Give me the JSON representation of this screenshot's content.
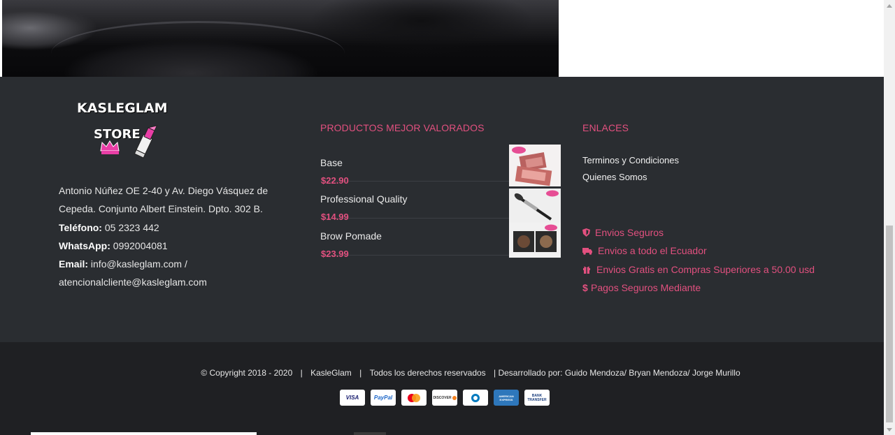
{
  "logo": {
    "line1": "KASLEGLAM",
    "line2": "STORE"
  },
  "address": {
    "street": "Antonio Núñez OE 2-40 y Av. Diego Vásquez de Cepeda. Conjunto Albert Einstein. Dpto. 302 B.",
    "phone_label": "Teléfono:",
    "phone": " 05 2323 442",
    "whatsapp_label": "WhatsApp:",
    "whatsapp": " 0992004081",
    "email_label": "Email:",
    "email": " info@kasleglam.com / atencionalcliente@kasleglam.com"
  },
  "products": {
    "title": "PRODUCTOS MEJOR VALORADOS",
    "items": [
      {
        "name": "Base",
        "price": "$22.90"
      },
      {
        "name": "Professional Quality",
        "price": "$14.99"
      },
      {
        "name": "Brow Pomade",
        "price": "$23.99"
      }
    ]
  },
  "links": {
    "title": "ENLACES",
    "items": [
      {
        "label": "Terminos y Condiciones"
      },
      {
        "label": "Quienes Somos"
      }
    ]
  },
  "features": [
    {
      "icon": "shield-icon",
      "label": "Envios Seguros"
    },
    {
      "icon": "truck-icon",
      "label": "Envios a todo el Ecuador"
    },
    {
      "icon": "gift-icon",
      "label": "Envios Gratis en Compras Superiores a 50.00 usd"
    },
    {
      "icon": "dollar-icon",
      "label": "Pagos Seguros Mediante"
    }
  ],
  "copyright": {
    "text": "© Copyright 2018 - 2020",
    "sep1": "|",
    "brand": "KasleGlam",
    "sep2": "|",
    "rights": "Todos los derechos reservados",
    "dev": "| Desarrollado por: Guido Mendoza/ Bryan Mendoza/ Jorge Murillo"
  },
  "payments": [
    {
      "name": "VISA"
    },
    {
      "name": "PayPal"
    },
    {
      "name": ""
    },
    {
      "name": "DISCOVER"
    },
    {
      "name": ""
    },
    {
      "name": "AMERICAN EXPRESS"
    },
    {
      "name": "BANK TRANSFER"
    }
  ],
  "colors": {
    "accent": "#e2507f",
    "footer_bg": "#2a2d31",
    "bottom_bg": "#1f2023"
  }
}
